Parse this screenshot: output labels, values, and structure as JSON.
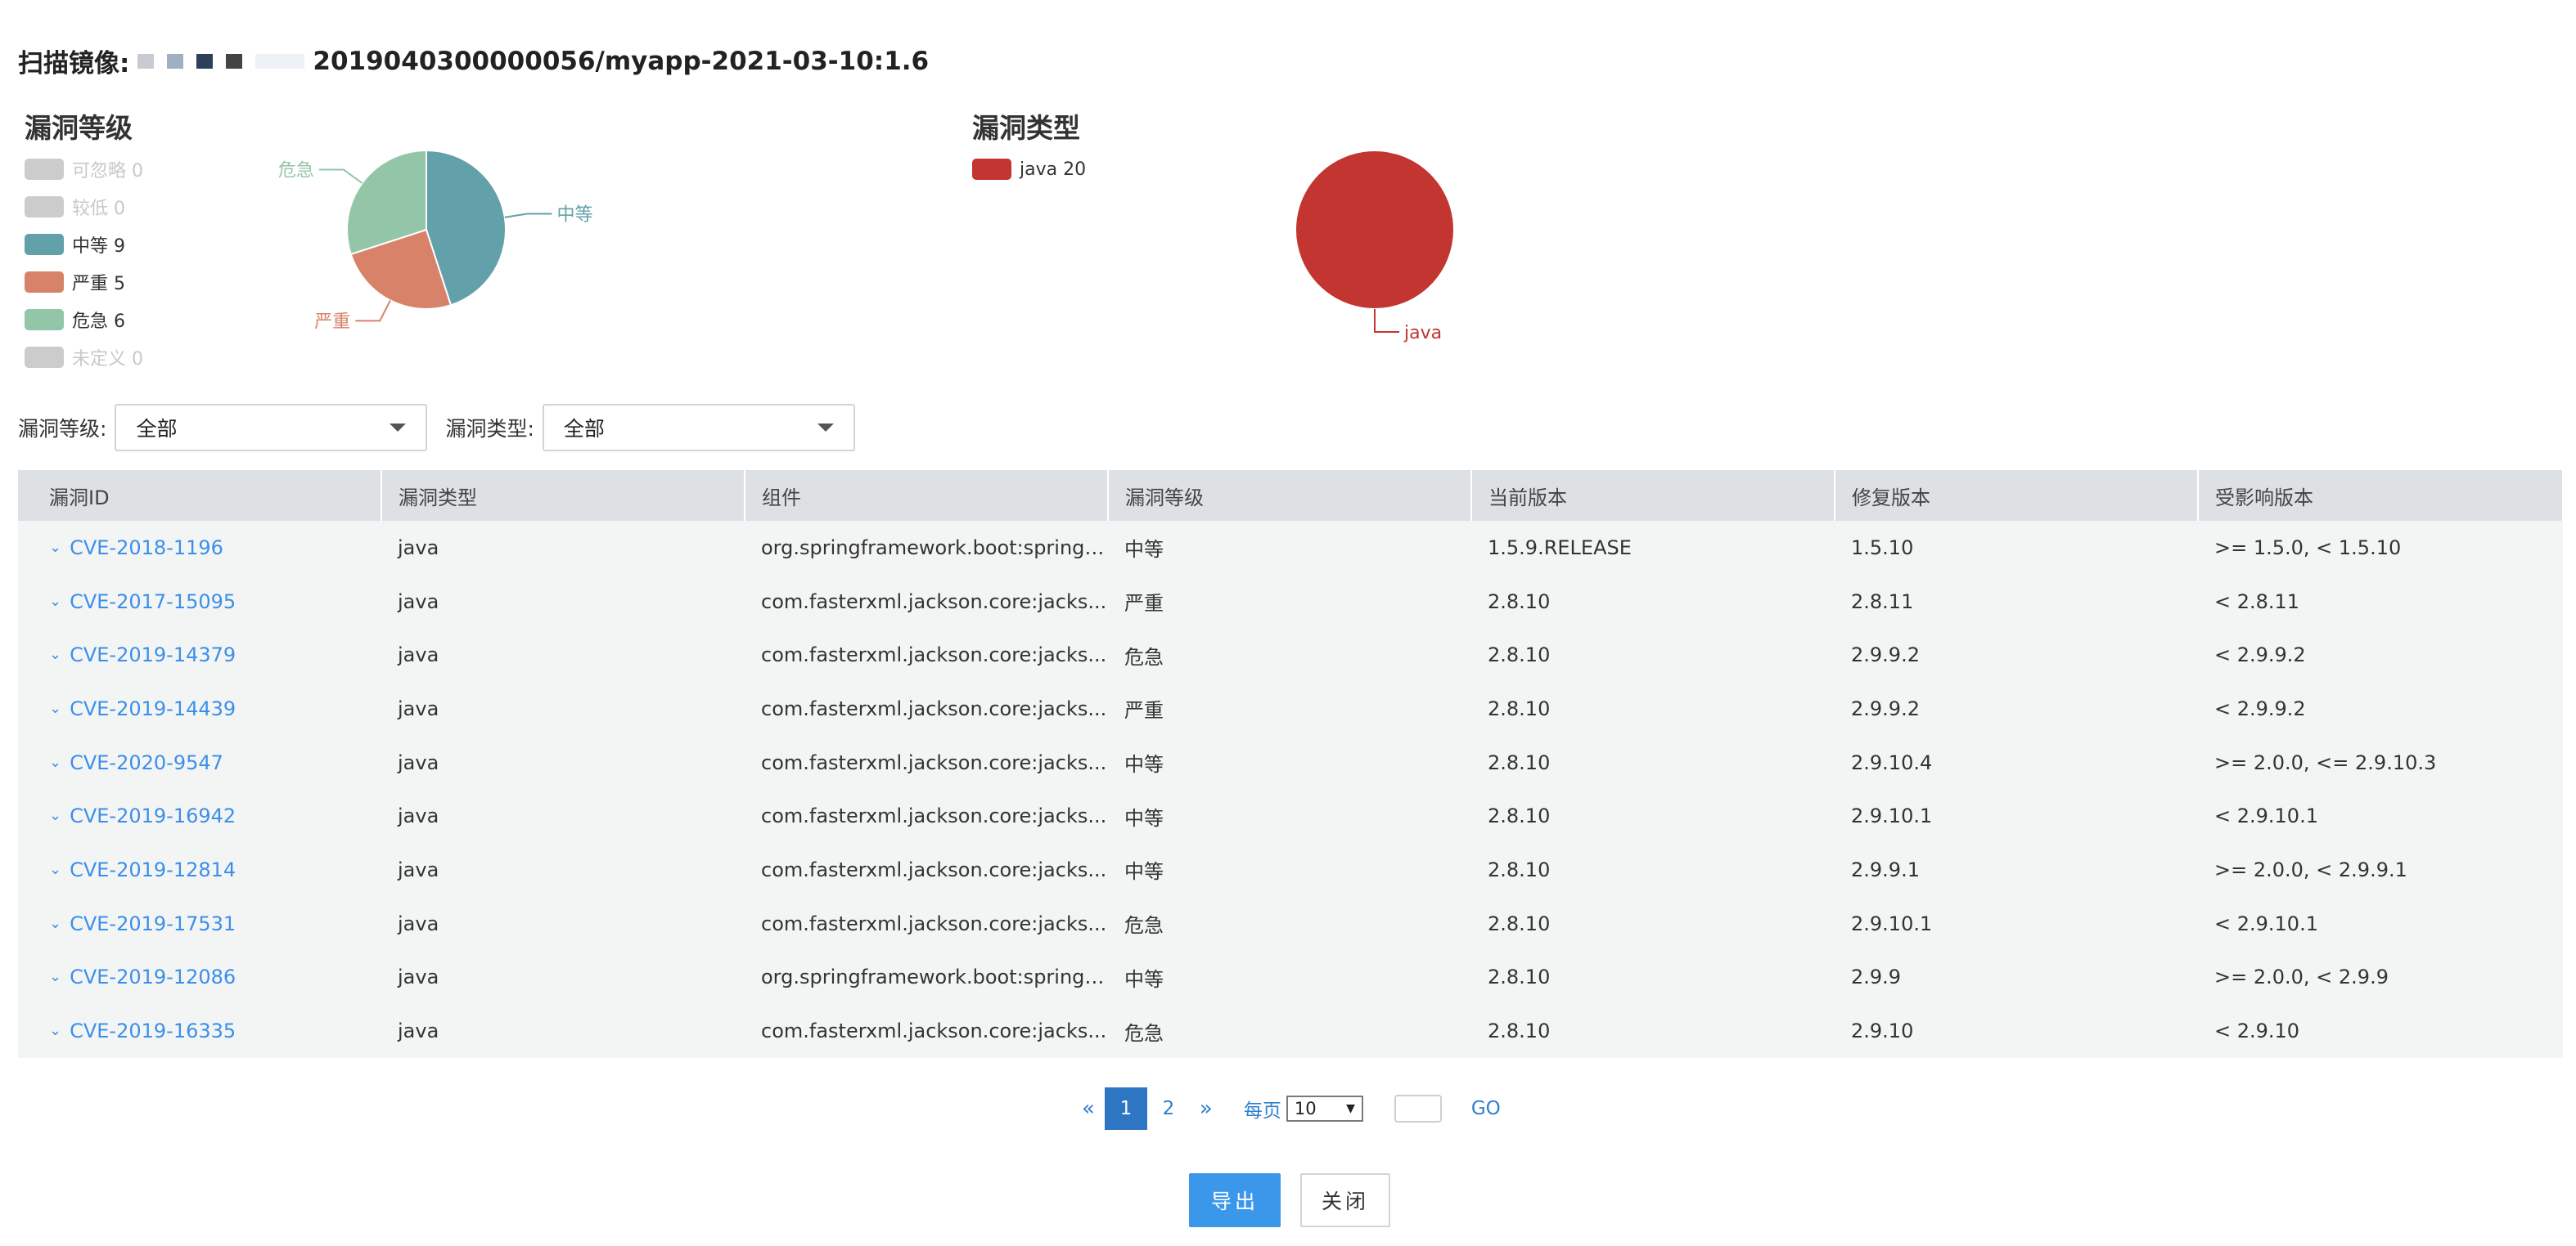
{
  "scan": {
    "label": "扫描镜像:",
    "image_visible": "2019040300000056/myapp-2021-03-10:1.6"
  },
  "colors": {
    "medium": "#62a0aa",
    "severe": "#d8826a",
    "critical": "#93c5a9",
    "java": "#c23531",
    "disabled": "#cccccc",
    "link": "#3c8fe8",
    "primary": "#3a97ea"
  },
  "chart_data": [
    {
      "type": "pie",
      "title": "漏洞等级",
      "legend_position": "left",
      "legend": [
        {
          "label": "可忽略 0",
          "name": "可忽略",
          "value": 0,
          "enabled": false
        },
        {
          "label": "较低 0",
          "name": "较低",
          "value": 0,
          "enabled": false
        },
        {
          "label": "中等 9",
          "name": "中等",
          "value": 9,
          "enabled": true
        },
        {
          "label": "严重 5",
          "name": "严重",
          "value": 5,
          "enabled": true
        },
        {
          "label": "危急 6",
          "name": "危急",
          "value": 6,
          "enabled": true
        },
        {
          "label": "未定义 0",
          "name": "未定义",
          "value": 0,
          "enabled": false
        }
      ],
      "slices": [
        {
          "name": "中等",
          "value": 9,
          "color": "#62a0aa"
        },
        {
          "name": "严重",
          "value": 5,
          "color": "#d8826a"
        },
        {
          "name": "危急",
          "value": 6,
          "color": "#93c5a9"
        }
      ]
    },
    {
      "type": "pie",
      "title": "漏洞类型",
      "legend_position": "left",
      "legend": [
        {
          "label": "java 20",
          "name": "java",
          "value": 20,
          "enabled": true
        }
      ],
      "slices": [
        {
          "name": "java",
          "value": 20,
          "color": "#c23531"
        }
      ]
    }
  ],
  "filters": {
    "level_label": "漏洞等级:",
    "level_value": "全部",
    "type_label": "漏洞类型:",
    "type_value": "全部"
  },
  "table": {
    "headers": [
      "漏洞ID",
      "漏洞类型",
      "组件",
      "漏洞等级",
      "当前版本",
      "修复版本",
      "受影响版本"
    ],
    "rows": [
      [
        "CVE-2018-1196",
        "java",
        "org.springframework.boot:spring-...",
        "中等",
        "1.5.9.RELEASE",
        "1.5.10",
        ">= 1.5.0, < 1.5.10"
      ],
      [
        "CVE-2017-15095",
        "java",
        "com.fasterxml.jackson.core:jacks...",
        "严重",
        "2.8.10",
        "2.8.11",
        "< 2.8.11"
      ],
      [
        "CVE-2019-14379",
        "java",
        "com.fasterxml.jackson.core:jacks...",
        "危急",
        "2.8.10",
        "2.9.9.2",
        "< 2.9.9.2"
      ],
      [
        "CVE-2019-14439",
        "java",
        "com.fasterxml.jackson.core:jacks...",
        "严重",
        "2.8.10",
        "2.9.9.2",
        "< 2.9.9.2"
      ],
      [
        "CVE-2020-9547",
        "java",
        "com.fasterxml.jackson.core:jacks...",
        "中等",
        "2.8.10",
        "2.9.10.4",
        ">= 2.0.0, <= 2.9.10.3"
      ],
      [
        "CVE-2019-16942",
        "java",
        "com.fasterxml.jackson.core:jacks...",
        "中等",
        "2.8.10",
        "2.9.10.1",
        "< 2.9.10.1"
      ],
      [
        "CVE-2019-12814",
        "java",
        "com.fasterxml.jackson.core:jacks...",
        "中等",
        "2.8.10",
        "2.9.9.1",
        ">= 2.0.0, < 2.9.9.1"
      ],
      [
        "CVE-2019-17531",
        "java",
        "com.fasterxml.jackson.core:jacks...",
        "危急",
        "2.8.10",
        "2.9.10.1",
        "< 2.9.10.1"
      ],
      [
        "CVE-2019-12086",
        "java",
        "org.springframework.boot:spring-...",
        "中等",
        "2.8.10",
        "2.9.9",
        ">= 2.0.0, < 2.9.9"
      ],
      [
        "CVE-2019-16335",
        "java",
        "com.fasterxml.jackson.core:jacks...",
        "危急",
        "2.8.10",
        "2.9.10",
        "< 2.9.10"
      ]
    ]
  },
  "pagination": {
    "prev": "«",
    "pages": [
      "1",
      "2"
    ],
    "current": "1",
    "next": "»",
    "per_page_label": "每页",
    "per_page_value": "10",
    "go_label": "GO"
  },
  "actions": {
    "export_label": "导出",
    "close_label": "关闭"
  }
}
